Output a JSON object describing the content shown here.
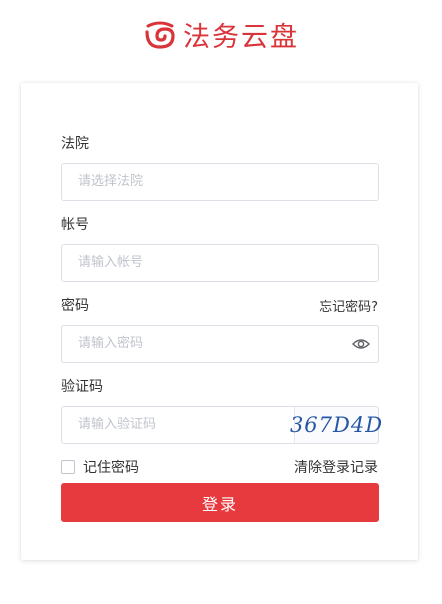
{
  "brand": {
    "name": "法务云盘",
    "color": "#d9343a"
  },
  "form": {
    "court": {
      "label": "法院",
      "placeholder": "请选择法院"
    },
    "account": {
      "label": "帐号",
      "placeholder": "请输入帐号"
    },
    "password": {
      "label": "密码",
      "placeholder": "请输入密码",
      "forgot": "忘记密码?",
      "toggle_icon": "eye-icon"
    },
    "captcha": {
      "label": "验证码",
      "placeholder": "请输入验证码",
      "image_text": "367D4D"
    },
    "remember": {
      "label": "记住密码",
      "checked": false
    },
    "clear_history": "清除登录记录",
    "submit": "登录"
  },
  "colors": {
    "primary": "#e63a3f",
    "border": "#dcdfe6",
    "placeholder": "#c0c4cc"
  }
}
